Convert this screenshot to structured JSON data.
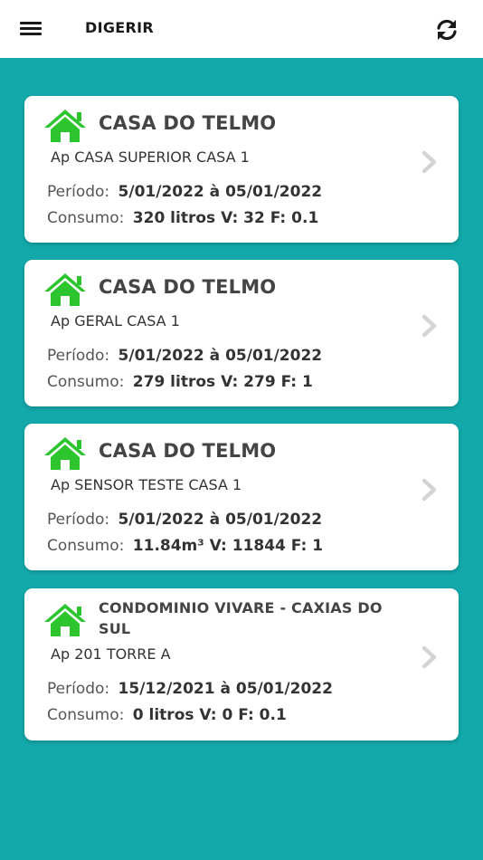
{
  "header": {
    "title": "DIGERIR",
    "menu_icon": "hamburger-menu-icon",
    "refresh_icon": "refresh-icon"
  },
  "colors": {
    "background": "#13a8aa",
    "house_icon": "#2dc52d",
    "card": "#ffffff"
  },
  "cards": [
    {
      "name": "CASA DO TELMO",
      "apartment": "Ap CASA SUPERIOR CASA 1",
      "period_label": "Período:",
      "period": "5/01/2022 à 05/01/2022",
      "consumption_label": "Consumo:",
      "consumption": "320 litros V: 32 F: 0.1"
    },
    {
      "name": "CASA DO TELMO",
      "apartment": "Ap GERAL CASA 1",
      "period_label": "Período:",
      "period": "5/01/2022 à 05/01/2022",
      "consumption_label": "Consumo:",
      "consumption": "279 litros V: 279 F: 1"
    },
    {
      "name": "CASA DO TELMO",
      "apartment": "Ap SENSOR TESTE CASA 1",
      "period_label": "Período:",
      "period": "5/01/2022 à 05/01/2022",
      "consumption_label": "Consumo:",
      "consumption": "11.84m³ V: 11844 F: 1"
    },
    {
      "name": "CONDOMINIO VIVARE - CAXIAS DO SUL",
      "apartment": "Ap 201 TORRE A",
      "period_label": "Período:",
      "period": "15/12/2021 à 05/01/2022",
      "consumption_label": "Consumo:",
      "consumption": "0 litros V: 0 F: 0.1"
    }
  ]
}
